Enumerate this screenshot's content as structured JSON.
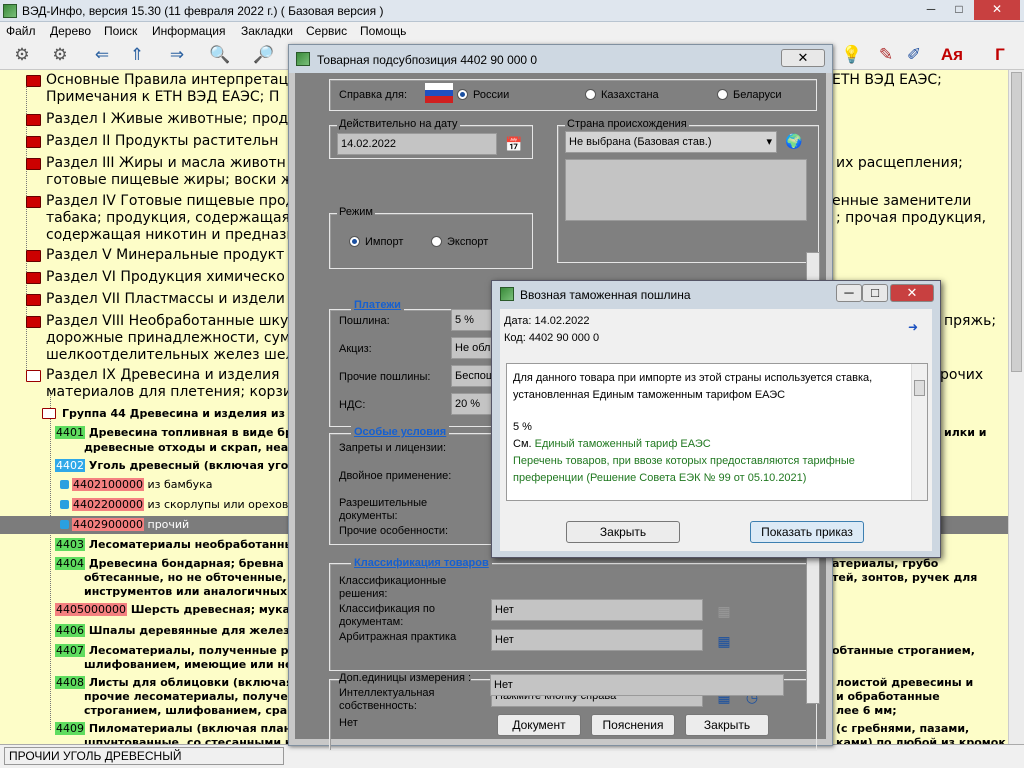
{
  "window": {
    "title": "ВЭД-Инфо, версия 15.30 (11 февраля 2022 г.) ( Базовая версия )",
    "min": "─",
    "max": "□",
    "close": "✕"
  },
  "menu": [
    "Файл",
    "Дерево",
    "Поиск",
    "Информация",
    "Закладки",
    "Сервис",
    "Помощь"
  ],
  "tree": {
    "sections": [
      {
        "l1": "Основные Правила интерпретаци",
        "l1r": "ЕТН ВЭД ЕАЭС;",
        "l2": "Примечания к ЕТН ВЭД ЕАЭС; П"
      },
      {
        "l1": "Раздел I Живые животные; прод"
      },
      {
        "l1": "Раздел II Продукты растительн"
      },
      {
        "l1": "Раздел III Жиры и масла животн",
        "l1r": "их расщепления;",
        "l2": "готовые пищевые жиры; воски жи"
      },
      {
        "l1": "Раздел IV Готовые пищевые прод",
        "l1r": "енные заменители",
        "l2": "табака; продукция, содержащая",
        "l2r": "; прочая продукция,",
        "l3": "содержащая никотин и предназн"
      },
      {
        "l1": "Раздел V Минеральные продукт"
      },
      {
        "l1": "Раздел VI Продукция химическо"
      },
      {
        "l1": "Раздел VII Пластмассы и издели"
      },
      {
        "l1": "Раздел VIII Необработанные шку",
        "l1r": "пряжь;",
        "l2": "дорожные принадлежности, сумк",
        "l3": "шелкоотделительных желез шелк"
      },
      {
        "l1": "Раздел IX Древесина и изделия",
        "l1r": "рочих",
        "l2": "материалов для плетения; корзи"
      }
    ],
    "group": "Группа 44 Древесина и изделия из н",
    "items": [
      {
        "code": "4401",
        "t1": "Древесина топливная в виде брев",
        "t1r": "илки и",
        "t2": "древесные отходы и скрап, неагл"
      },
      {
        "code": "4402",
        "t1": "Уголь древесный (включая уголь,"
      },
      {
        "code": "4403",
        "t1": "Лесоматериалы необработанные,"
      },
      {
        "code": "4404",
        "t1": "Древесина бондарная; бревна рас",
        "t1r": "атериалы, грубо",
        "t2": "обтесанные, но не обточенные, не",
        "t2r": "тей, зонтов, ручек для",
        "t3": "инструментов или аналогичных из"
      },
      {
        "code": "4405000000",
        "t1": "Шерсть древесная; мука др"
      },
      {
        "code": "4406",
        "t1": "Шпалы деревянные для железнод"
      },
      {
        "code": "4407",
        "t1": "Лесоматериалы, полученные расп",
        "t1r": "обтанные строганием,",
        "t2": "шлифованием, имеющие или не им"
      },
      {
        "code": "4408",
        "t1": "Листы для облицовки (включая по",
        "t1r": "лоистой древесины и",
        "t2": "прочие лесоматериалы, полученн",
        "t2r": "и обработанные",
        "t3": "строганием, шлифованием, сращ",
        "t3r": "лее 6 мм;"
      },
      {
        "code": "4409",
        "t1": "Пиломатериалы (включая планки",
        "t1r": "(с гребнями, пазами,",
        "t2": "шпунтованные, со стесанными кр",
        "t2r": "ками) по любой из кромок"
      }
    ],
    "sub": [
      {
        "code": "4402100000",
        "text": "из бамбука"
      },
      {
        "code": "4402200000",
        "text": "из скорлупы или орехов"
      },
      {
        "code": "4402900000",
        "text": "прочий"
      }
    ]
  },
  "status": "ПРОЧИИ УГОЛЬ ДРЕВЕСНЫЙ",
  "dialog": {
    "title": "Товарная подсубпозиция 4402 90 000 0",
    "close": "✕",
    "ref_label": "Справка для:",
    "countries": [
      "России",
      "Казахстана",
      "Беларуси"
    ],
    "date_label": "Действительно на дату",
    "date": "14.02.2022",
    "origin_label": "Страна происхождения",
    "origin_value": "Не выбрана (Базовая став.)",
    "mode_label": "Режим",
    "modes": [
      "Импорт",
      "Экспорт"
    ],
    "payments_title": "Платежи",
    "payments": [
      {
        "label": "Пошлина:",
        "value": "5 %"
      },
      {
        "label": "Акциз:",
        "value": "Не обл"
      },
      {
        "label": "Прочие пошлины:",
        "value": "Беспош"
      },
      {
        "label": "НДС:",
        "value": "20 %"
      }
    ],
    "special_title": "Особые условия",
    "special": [
      "Запреты и лицензии:",
      "Двойное применение:",
      "Разрешительные документы:",
      "Прочие особенности:"
    ],
    "class_title": "Классификация товаров",
    "class_rows": [
      {
        "label": "Классификационные решения:",
        "value": ""
      },
      {
        "label": "Классификация по документам:",
        "value": "Нет"
      },
      {
        "label": "Арбитражная практика",
        "value": "Нет"
      }
    ],
    "ip_label": "Интеллектуальная собственность:",
    "ip_value": "Нажмите кнопку справа",
    "units_label": "Доп.единицы измерения :",
    "units_value": "Нет",
    "buttons": [
      "Документ",
      "Пояснения",
      "Закрыть"
    ]
  },
  "duty_dialog": {
    "title": "Ввозная таможенная пошлина",
    "date": "Дата: 14.02.2022",
    "code": "Код:   4402 90 000 0",
    "line1": "Для данного товара при импорте из этой страны используется ставка,",
    "line2": "установленная Единым таможенным тарифом ЕАЭС",
    "rate": "5 %",
    "see": "См.",
    "link1": "Единый таможенный тариф ЕАЭС",
    "link2a": "Перечень товаров, при ввозе которых предоставляются тарифные",
    "link2b": "преференции (Решение Совета ЕЭК № 99 от 05.10.2021)",
    "btn_close": "Закрыть",
    "btn_show": "Показать приказ",
    "min": "─",
    "max": "□",
    "close": "✕"
  },
  "colors": {
    "tree_bg": "#fdfdc8",
    "code_green": "#5fdc5f",
    "code_blue": "#2fa8e8",
    "code_red": "#f48080",
    "link_green": "#207820",
    "section_blue": "#1660d0"
  }
}
